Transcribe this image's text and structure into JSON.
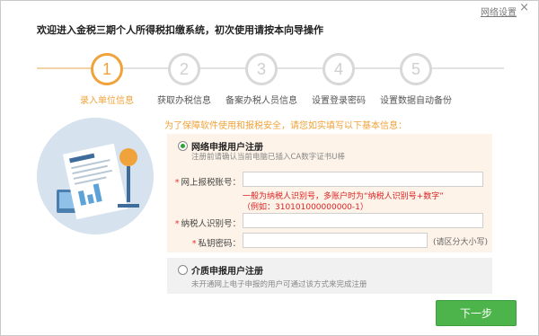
{
  "window": {
    "network_settings_label": "网络设置",
    "close_glyph": "×"
  },
  "title": "欢迎进入金税三期个人所得税扣缴系统，初次使用请按本向导操作",
  "steps": [
    {
      "number": "1",
      "label": "录入单位信息",
      "active": true
    },
    {
      "number": "2",
      "label": "获取办税信息",
      "active": false
    },
    {
      "number": "3",
      "label": "备案办税人员信息",
      "active": false
    },
    {
      "number": "4",
      "label": "设置登录密码",
      "active": false
    },
    {
      "number": "5",
      "label": "设置数据自动备份",
      "active": false
    }
  ],
  "notice": "为了保障软件使用和报税安全，请您如实填写以下基本信息：",
  "option_network": {
    "label": "网络申报用户注册",
    "hint": "注册前请确认当前电脑已插入CA数字证书U棒",
    "checked": true
  },
  "form": {
    "account_label": "网上报税账号：",
    "account_value": "",
    "red_note_line1": "一般为纳税人识别号，多账户时为“纳税人识别号+数字”",
    "red_note_line2": "（例如：310101000000000-1）",
    "taxid_label": "纳税人识别号：",
    "taxid_value": "",
    "key_label": "私钥密码：",
    "key_value": "",
    "key_note": "(请区分大小写)",
    "required_mark": "*"
  },
  "option_media": {
    "label": "介质申报用户注册",
    "hint": "未开通网上电子申报的用户可通过该方式来完成注册",
    "checked": false
  },
  "next_button": "下一步",
  "colors": {
    "accent": "#f0a33a",
    "button": "#4cb44a",
    "required": "#d22"
  }
}
